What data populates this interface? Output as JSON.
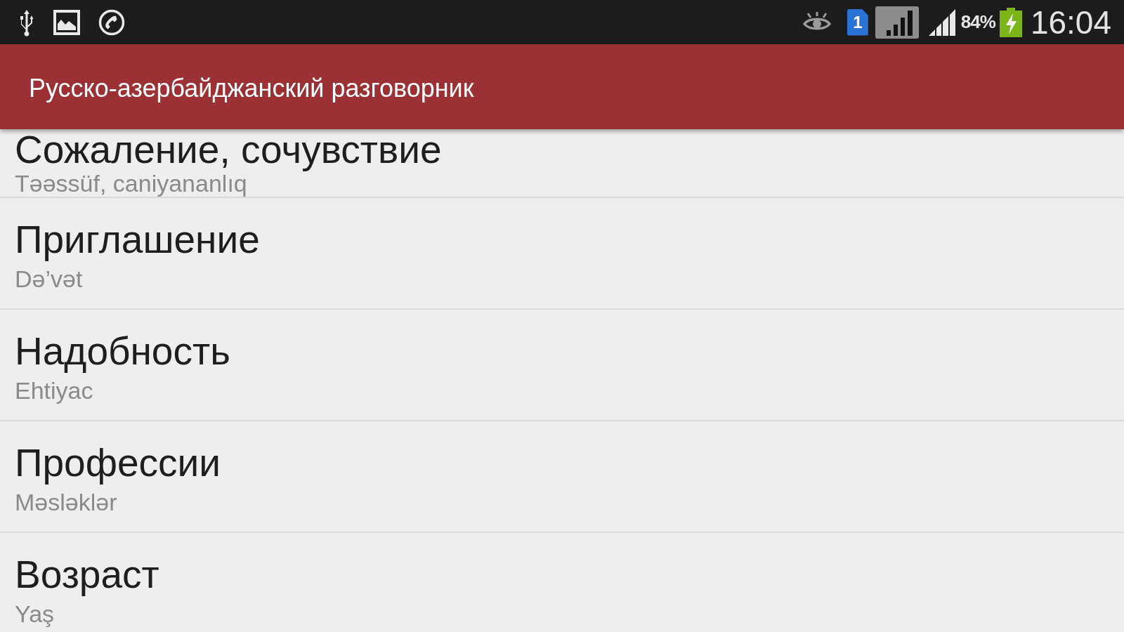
{
  "status_bar": {
    "sim_slot": "1",
    "battery": "84%",
    "time": "16:04"
  },
  "app_bar": {
    "title": "Русско-азербайджанский разговорник"
  },
  "list": {
    "items": [
      {
        "title": "Сожаление, сочувствие",
        "subtitle": "Təəssüf, caniyananlıq"
      },
      {
        "title": "Приглашение",
        "subtitle": "Də’vət"
      },
      {
        "title": "Надобность",
        "subtitle": "Ehtiyac"
      },
      {
        "title": "Профессии",
        "subtitle": "Məsləklər"
      },
      {
        "title": "Возраст",
        "subtitle": "Yaş"
      }
    ]
  }
}
